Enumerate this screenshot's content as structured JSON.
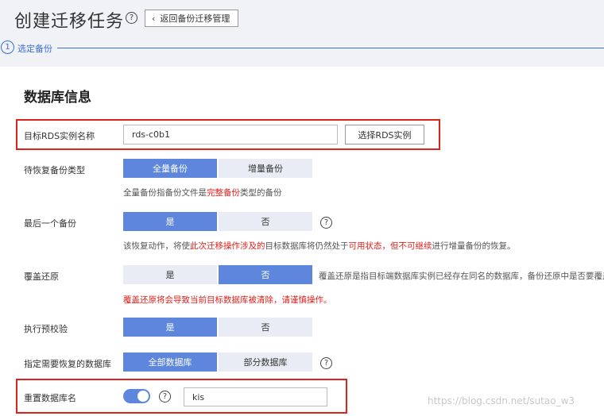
{
  "header": {
    "title": "创建迁移任务",
    "help_icon": "question-circle-icon",
    "back_button_label": "返回备份迁移管理",
    "back_icon": "chevron-left-icon"
  },
  "steps": [
    {
      "number": "1",
      "label": "选定备份",
      "status": "active"
    }
  ],
  "section": {
    "title": "数据库信息"
  },
  "form": {
    "target_instance": {
      "label": "目标RDS实例名称",
      "value": "rds-c0b1",
      "select_button": "选择RDS实例"
    },
    "restore_type": {
      "label": "待恢复备份类型",
      "options": [
        "全量备份",
        "增量备份"
      ],
      "selected": "全量备份",
      "hint_prefix": "全量备份指备份文件是",
      "hint_highlight": "完整备份",
      "hint_suffix": "类型的备份"
    },
    "last_backup": {
      "label": "最后一个备份",
      "options": [
        "是",
        "否"
      ],
      "selected": "是",
      "hint_part1": "该恢复动作，将使",
      "hint_part2": "此次迁移操作涉及的",
      "hint_part3": "目标数据库将仍然处于",
      "hint_part4": "可用状态，但不可继续",
      "hint_part5": "进行增量备份的恢复。"
    },
    "overwrite_restore": {
      "label": "覆盖还原",
      "options": [
        "是",
        "否"
      ],
      "selected": "否",
      "inline_hint": "覆盖还原是指目标端数据库实例已经存在同名的数据库，备份还原中是否要覆盖",
      "warning": "覆盖还原将会导致当前目标数据库被清除，请谨慎操作。"
    },
    "pre_check": {
      "label": "执行预校验",
      "options": [
        "是",
        "否"
      ],
      "selected": "是"
    },
    "restore_databases": {
      "label": "指定需要恢复的数据库",
      "options": [
        "全部数据库",
        "部分数据库"
      ],
      "selected": "全部数据库"
    },
    "rename_database": {
      "label": "重置数据库名",
      "toggle_on": true,
      "value": "kis"
    }
  },
  "watermark": "https://blog.csdn.net/sutao_w3",
  "colors": {
    "accent": "#5e86dc",
    "step_blue": "#3b6ed8",
    "warning_red": "#e0201b",
    "segment_inactive": "#e9ecf5"
  }
}
